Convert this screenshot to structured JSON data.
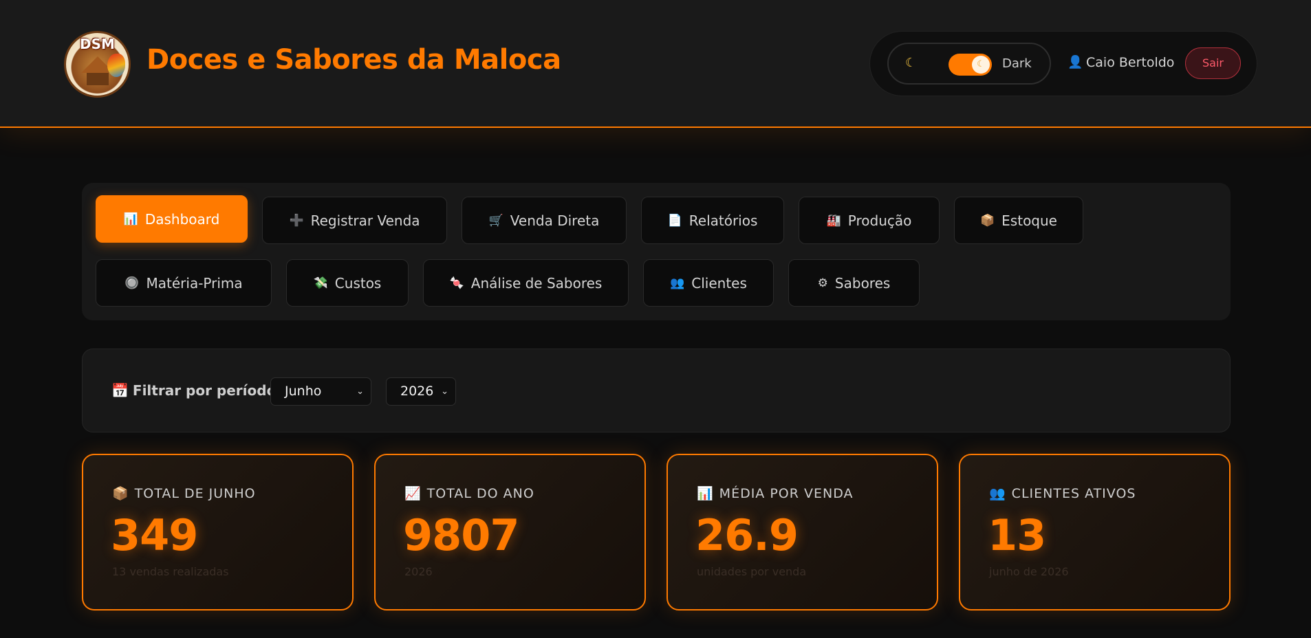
{
  "header": {
    "logo_text": "DSM",
    "brand": "Doces e Sabores da Maloca",
    "theme_label": "Dark",
    "user_name": "Caio Bertoldo",
    "logout_label": "Sair",
    "accent": "#ff7a00"
  },
  "nav": {
    "items": [
      {
        "icon": "📊",
        "label": "Dashboard"
      },
      {
        "icon": "➕",
        "label": "Registrar Venda"
      },
      {
        "icon": "🛒",
        "label": "Venda Direta"
      },
      {
        "icon": "📄",
        "label": "Relatórios"
      },
      {
        "icon": "🏭",
        "label": "Produção"
      },
      {
        "icon": "📦",
        "label": "Estoque"
      },
      {
        "icon": "🔘",
        "label": "Matéria-Prima"
      },
      {
        "icon": "💸",
        "label": "Custos"
      },
      {
        "icon": "🍬",
        "label": "Análise de Sabores"
      },
      {
        "icon": "👥",
        "label": "Clientes"
      },
      {
        "icon": "⚙",
        "label": "Sabores"
      }
    ],
    "active": "Dashboard"
  },
  "filter": {
    "icon": "📅",
    "label": "Filtrar por período:",
    "month": "Junho",
    "year": "2026"
  },
  "stats": [
    {
      "icon": "📦",
      "label": "TOTAL DE JUNHO",
      "value": "349",
      "sub": "13 vendas realizadas"
    },
    {
      "icon": "📈",
      "label": "TOTAL DO ANO",
      "value": "9807",
      "sub": "2026"
    },
    {
      "icon": "📊",
      "label": "MÉDIA POR VENDA",
      "value": "26.9",
      "sub": "unidades por venda"
    },
    {
      "icon": "👥",
      "label": "CLIENTES ATIVOS",
      "value": "13",
      "sub": "junho de 2026"
    }
  ]
}
